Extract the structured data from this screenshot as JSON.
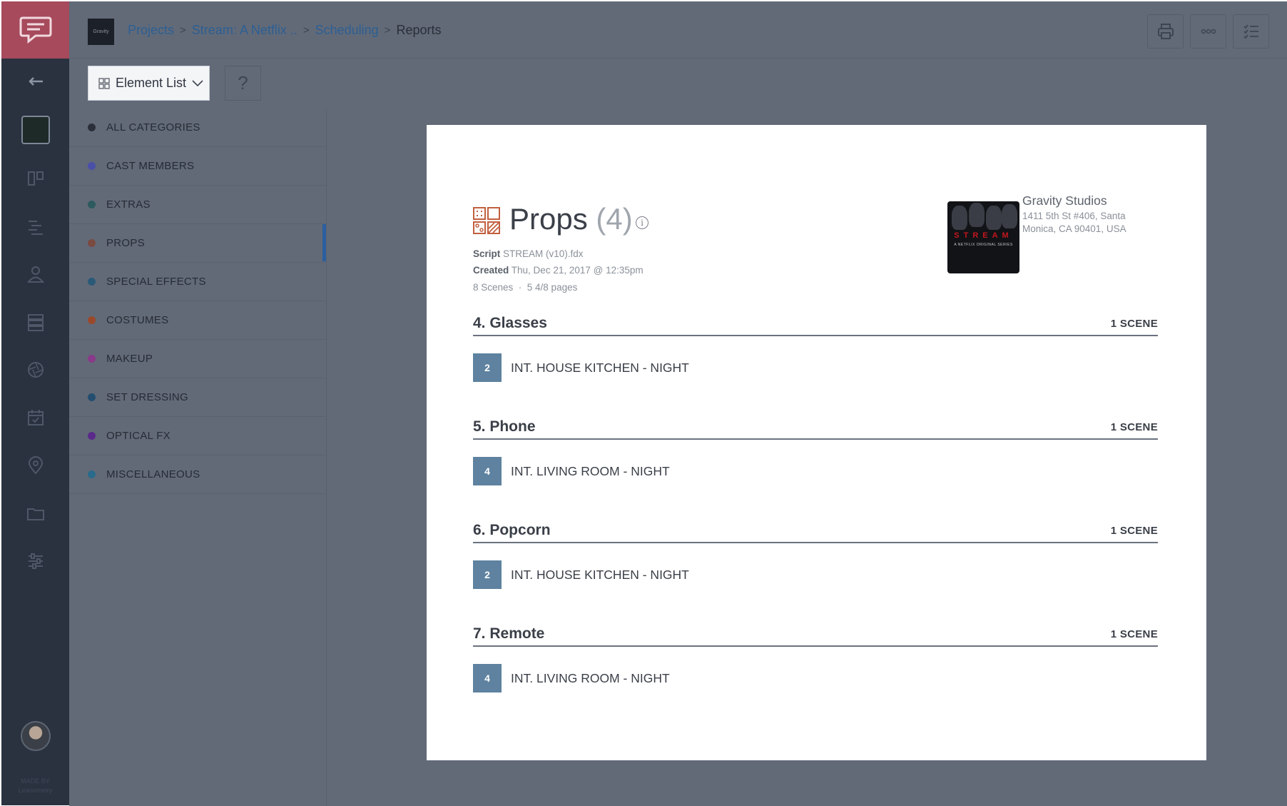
{
  "breadcrumb": {
    "logo_text": "Gravity",
    "projects": "Projects",
    "project": "Stream: A Netflix ..",
    "scheduling": "Scheduling",
    "current": "Reports"
  },
  "toolbar": {
    "element_list_label": "Element List",
    "help_label": "?"
  },
  "categories": [
    {
      "label": "ALL CATEGORIES",
      "color": "#2a2f3a"
    },
    {
      "label": "CAST MEMBERS",
      "color": "#4a4fa8"
    },
    {
      "label": "EXTRAS",
      "color": "#2c5a5e"
    },
    {
      "label": "PROPS",
      "color": "#7a4a40"
    },
    {
      "label": "SPECIAL EFFECTS",
      "color": "#2a5a78"
    },
    {
      "label": "COSTUMES",
      "color": "#9a4a2a"
    },
    {
      "label": "MAKEUP",
      "color": "#8a3a8a"
    },
    {
      "label": "SET DRESSING",
      "color": "#234e70"
    },
    {
      "label": "OPTICAL FX",
      "color": "#5a2a8a"
    },
    {
      "label": "MISCELLANEOUS",
      "color": "#2a6a8a"
    }
  ],
  "active_category": "PROPS",
  "report": {
    "title": "Props",
    "count": "(4)",
    "script_label": "Script",
    "script_value": "STREAM (v10).fdx",
    "created_label": "Created",
    "created_value": "Thu, Dec 21, 2017 @ 12:35pm",
    "scenes_pages": "8 Scenes  ·  5 4/8 pages",
    "poster_title": "STREAM",
    "poster_sub": "A NETFLIX ORIGINAL SERIES",
    "studio_name": "Gravity Studios",
    "studio_addr_1": "1411 5th St #406, Santa",
    "studio_addr_2": "Monica, CA 90401, USA",
    "sections": [
      {
        "title": "4. Glasses",
        "count": "1 SCENE",
        "scene_num": "2",
        "scene_name": "INT. HOUSE KITCHEN - NIGHT"
      },
      {
        "title": "5. Phone",
        "count": "1 SCENE",
        "scene_num": "4",
        "scene_name": "INT. LIVING ROOM - NIGHT"
      },
      {
        "title": "6. Popcorn",
        "count": "1 SCENE",
        "scene_num": "2",
        "scene_name": "INT. HOUSE KITCHEN - NIGHT"
      },
      {
        "title": "7. Remote",
        "count": "1 SCENE",
        "scene_num": "4",
        "scene_name": "INT. LIVING ROOM - NIGHT"
      }
    ]
  },
  "footer": {
    "made_by_1": "MADE BY",
    "made_by_2": "Leanometry"
  }
}
